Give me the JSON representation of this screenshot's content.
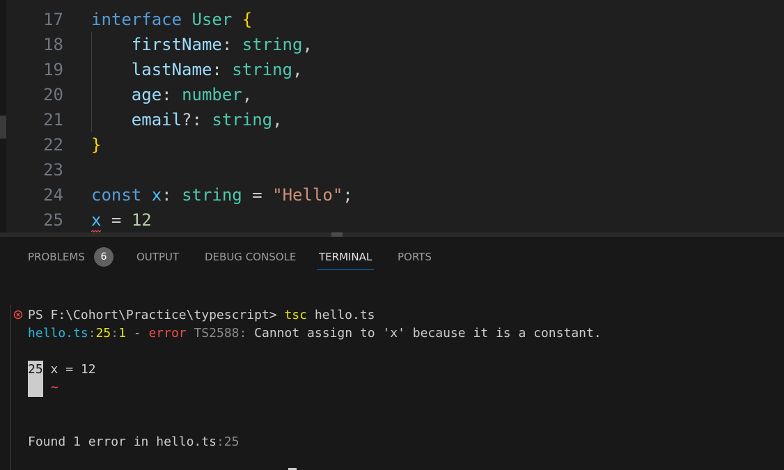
{
  "editor": {
    "lines": [
      {
        "number": "17",
        "tokens": [
          {
            "text": "interface",
            "kind": "kw"
          },
          {
            "text": " ",
            "kind": "punc"
          },
          {
            "text": "User",
            "kind": "type"
          },
          {
            "text": " ",
            "kind": "punc"
          },
          {
            "text": "{",
            "kind": "brace"
          }
        ]
      },
      {
        "number": "18",
        "tokens": [
          {
            "text": "    ",
            "kind": "punc"
          },
          {
            "text": "firstName",
            "kind": "prop"
          },
          {
            "text": ": ",
            "kind": "punc"
          },
          {
            "text": "string",
            "kind": "type"
          },
          {
            "text": ",",
            "kind": "punc"
          }
        ]
      },
      {
        "number": "19",
        "tokens": [
          {
            "text": "    ",
            "kind": "punc"
          },
          {
            "text": "lastName",
            "kind": "prop"
          },
          {
            "text": ": ",
            "kind": "punc"
          },
          {
            "text": "string",
            "kind": "type"
          },
          {
            "text": ",",
            "kind": "punc"
          }
        ]
      },
      {
        "number": "20",
        "tokens": [
          {
            "text": "    ",
            "kind": "punc"
          },
          {
            "text": "age",
            "kind": "prop"
          },
          {
            "text": ": ",
            "kind": "punc"
          },
          {
            "text": "number",
            "kind": "type"
          },
          {
            "text": ",",
            "kind": "punc"
          }
        ]
      },
      {
        "number": "21",
        "tokens": [
          {
            "text": "    ",
            "kind": "punc"
          },
          {
            "text": "email",
            "kind": "prop"
          },
          {
            "text": "?: ",
            "kind": "punc"
          },
          {
            "text": "string",
            "kind": "type"
          },
          {
            "text": ",",
            "kind": "punc"
          }
        ]
      },
      {
        "number": "22",
        "tokens": [
          {
            "text": "}",
            "kind": "brace"
          }
        ]
      },
      {
        "number": "23",
        "tokens": []
      },
      {
        "number": "24",
        "tokens": [
          {
            "text": "const",
            "kind": "kw"
          },
          {
            "text": " ",
            "kind": "punc"
          },
          {
            "text": "x",
            "kind": "var"
          },
          {
            "text": ": ",
            "kind": "punc"
          },
          {
            "text": "string",
            "kind": "type"
          },
          {
            "text": " = ",
            "kind": "punc"
          },
          {
            "text": "\"Hello\"",
            "kind": "str"
          },
          {
            "text": ";",
            "kind": "punc"
          }
        ]
      },
      {
        "number": "25",
        "tokens": [
          {
            "text": "x",
            "kind": "var"
          },
          {
            "text": " = ",
            "kind": "punc"
          },
          {
            "text": "12",
            "kind": "num"
          }
        ]
      }
    ]
  },
  "panel": {
    "tabs": {
      "problems": "PROBLEMS",
      "problems_count": "6",
      "output": "OUTPUT",
      "debug_console": "DEBUG CONSOLE",
      "terminal": "TERMINAL",
      "ports": "PORTS"
    },
    "active_tab": "TERMINAL"
  },
  "terminal": {
    "prompt": "PS F:\\Cohort\\Practice\\typescript>",
    "command": "tsc",
    "command_arg": "hello.ts",
    "error": {
      "file": "hello.ts",
      "line": "25",
      "col": "1",
      "severity": "error",
      "code": "TS2588:",
      "message": "Cannot assign to 'x' because it is a constant."
    },
    "snippet": {
      "line_number": "25",
      "code": "x = 12",
      "marker": "~"
    },
    "summary": {
      "text": "Found 1 error in hello.ts",
      "location": ":25"
    }
  },
  "colors": {
    "keyword": "#569cd6",
    "type": "#4ec9b0",
    "property": "#9cdcfe",
    "variable": "#4fc1ff",
    "brace": "#ffd700",
    "string": "#ce9178",
    "number": "#b5cea8",
    "error": "#f14c4c",
    "accent": "#0078d4"
  }
}
